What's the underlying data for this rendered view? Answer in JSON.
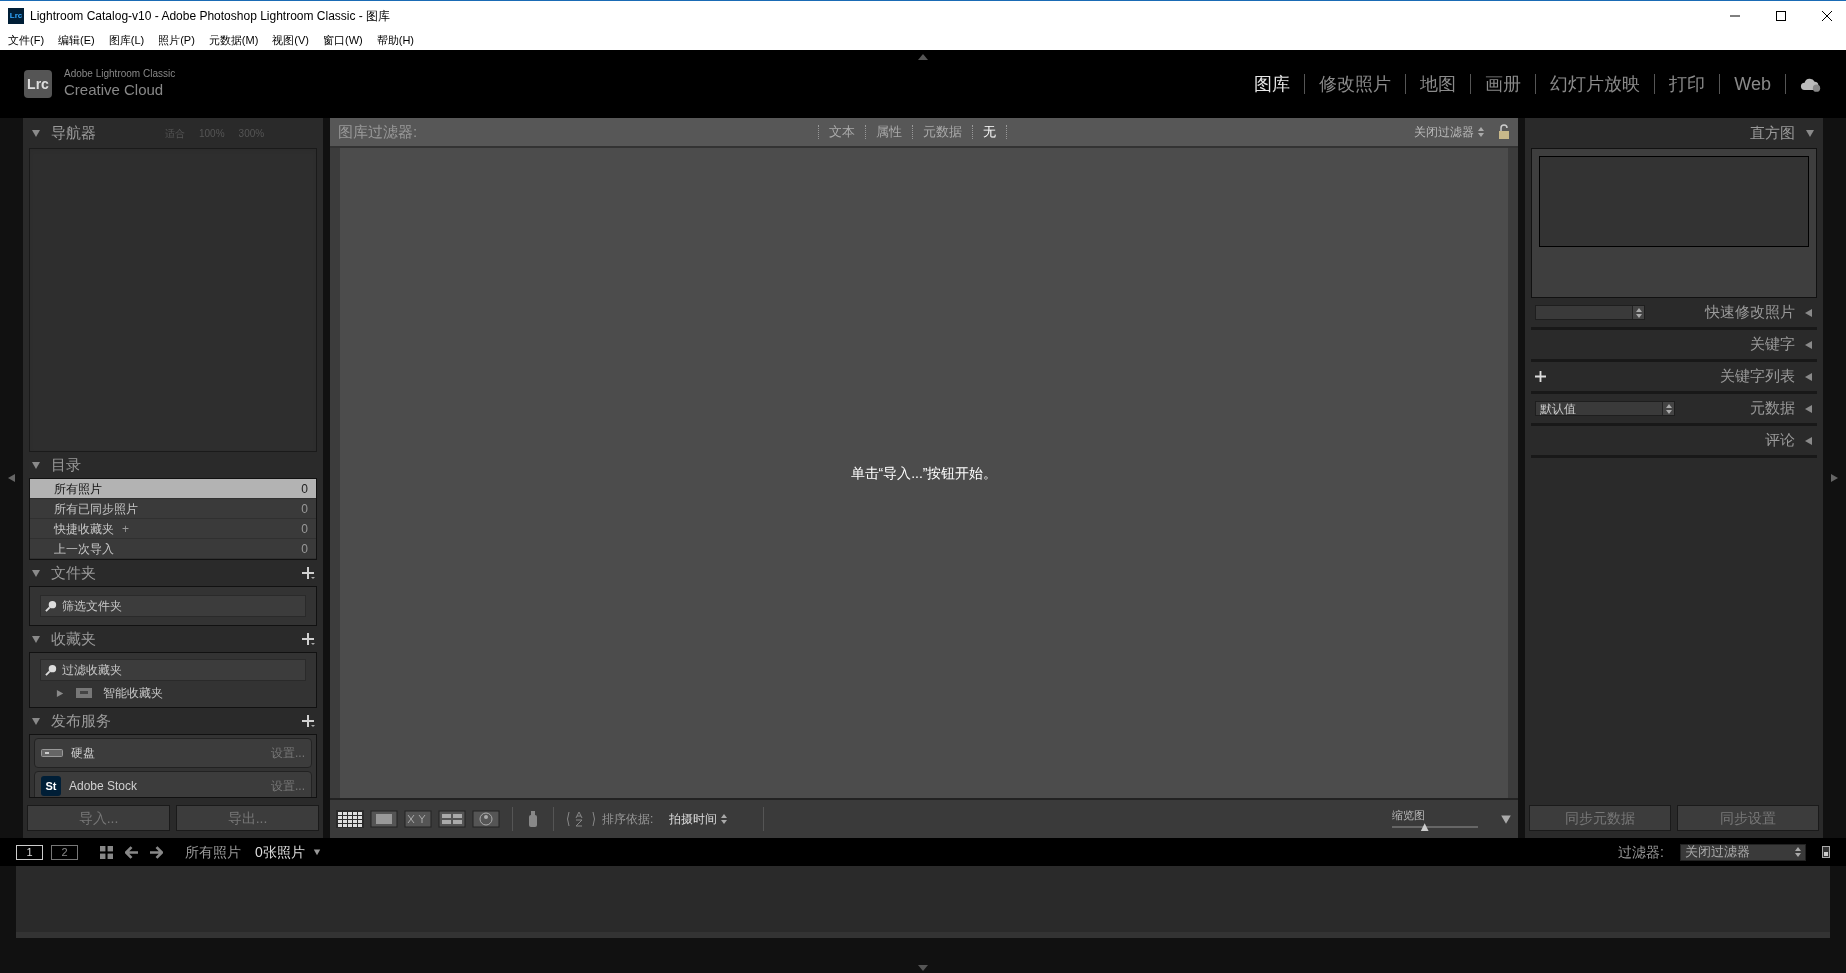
{
  "window": {
    "title": "Lightroom Catalog-v10 - Adobe Photoshop Lightroom Classic - 图库"
  },
  "menu": [
    "文件(F)",
    "编辑(E)",
    "图库(L)",
    "照片(P)",
    "元数据(M)",
    "视图(V)",
    "窗口(W)",
    "帮助(H)"
  ],
  "app_icon": "Lrc",
  "identity": {
    "logo": "Lrc",
    "line_1": "Adobe Lightroom Classic",
    "line_2": "Creative Cloud"
  },
  "modules": [
    {
      "label": "图库",
      "selected": true
    },
    {
      "label": "修改照片",
      "selected": false
    },
    {
      "label": "地图",
      "selected": false
    },
    {
      "label": "画册",
      "selected": false
    },
    {
      "label": "幻灯片放映",
      "selected": false
    },
    {
      "label": "打印",
      "selected": false
    },
    {
      "label": "Web",
      "selected": false
    }
  ],
  "left_panel": {
    "navigator": {
      "title": "导航器",
      "zoom_options": [
        "适合",
        "100%",
        "300%"
      ]
    },
    "catalog": {
      "title": "目录",
      "items": [
        {
          "label": "所有照片",
          "count": "0",
          "selected": true
        },
        {
          "label": "所有已同步照片",
          "count": "0",
          "selected": false
        },
        {
          "label": "快捷收藏夹",
          "marker": "+",
          "count": "0",
          "selected": false
        },
        {
          "label": "上一次导入",
          "count": "0",
          "selected": false
        }
      ]
    },
    "folders": {
      "title": "文件夹",
      "placeholder": "筛选文件夹"
    },
    "collections": {
      "title": "收藏夹",
      "placeholder": "过滤收藏夹",
      "items": [
        {
          "label": "智能收藏夹",
          "expanded": false
        }
      ]
    },
    "publish": {
      "title": "发布服务",
      "services": [
        {
          "kind": "disk",
          "name": "硬盘",
          "action": "设置..."
        },
        {
          "kind": "stock",
          "badge": "St",
          "name": "Adobe Stock",
          "action": "设置..."
        }
      ]
    },
    "buttons": [
      "导入...",
      "导出..."
    ]
  },
  "filter_bar": {
    "label": "图库过滤器:",
    "tabs": [
      {
        "label": "文本",
        "selected": false
      },
      {
        "label": "属性",
        "selected": false
      },
      {
        "label": "元数据",
        "selected": false
      },
      {
        "label": "无",
        "selected": true
      }
    ],
    "preset": "关闭过滤器"
  },
  "grid": {
    "message": "单击“导入...”按钮开始。"
  },
  "toolbar": {
    "sort_label": "排序依据:",
    "sort_value": "拍摄时间",
    "thumbnail_label": "缩览图",
    "thumbnail_size": {
      "level": 0.38
    }
  },
  "right_panel": {
    "histogram": {
      "title": "直方图"
    },
    "panels": [
      {
        "title": "快速修改照片",
        "kind": "select"
      },
      {
        "title": "关键字",
        "kind": "plain"
      },
      {
        "title": "关键字列表",
        "kind": "add"
      },
      {
        "title": "元数据",
        "kind": "select",
        "value": "默认值"
      },
      {
        "title": "评论",
        "kind": "plain"
      }
    ],
    "buttons": [
      "同步元数据",
      "同步设置"
    ]
  },
  "filmstrip": {
    "pages": [
      {
        "label": "1",
        "selected": true
      },
      {
        "label": "2",
        "selected": false
      }
    ],
    "source": "所有照片",
    "count": "0张照片",
    "filter_label": "过滤器:",
    "filter_value": "关闭过滤器"
  }
}
